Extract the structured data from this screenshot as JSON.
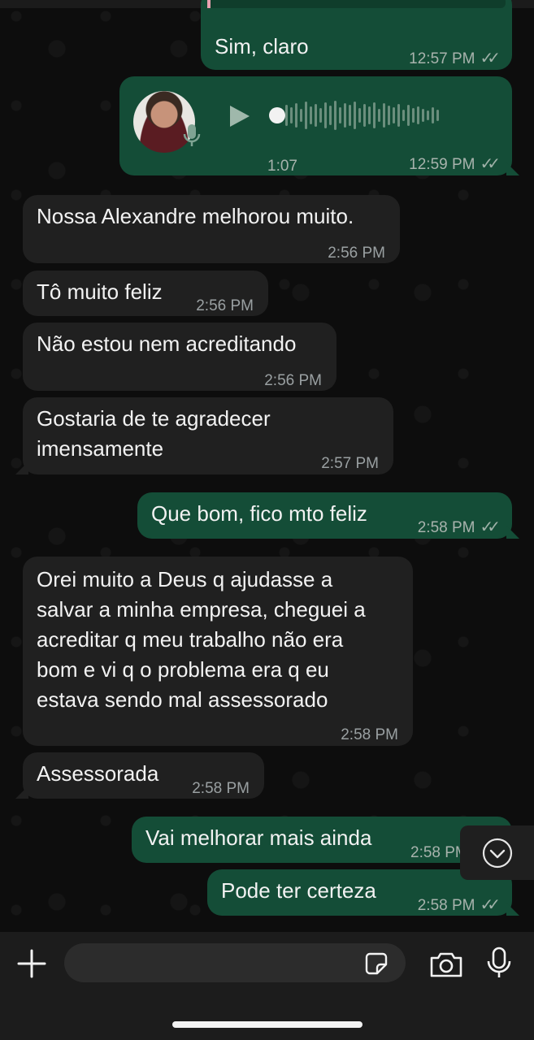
{
  "messages": [
    {
      "text": "Sim, claro",
      "time": "12:57 PM"
    },
    {
      "duration": "1:07",
      "time": "12:59 PM"
    },
    {
      "text": "Nossa Alexandre melhorou muito.",
      "time": "2:56 PM"
    },
    {
      "text": "Tô muito feliz",
      "time": "2:56 PM"
    },
    {
      "text": "Não estou nem acreditando",
      "time": "2:56 PM"
    },
    {
      "text": "Gostaria de te agradecer\nimensamente",
      "time": "2:57 PM"
    },
    {
      "text": "Que bom, fico mto feliz",
      "time": "2:58 PM"
    },
    {
      "text": "Orei muito a Deus q ajudasse a\nsalvar a minha empresa, cheguei a\nacreditar q meu trabalho não era\nbom e vi q o problema era q eu\nestava sendo mal assessorado",
      "time": "2:58 PM"
    },
    {
      "text": "Assessorada",
      "time": "2:58 PM"
    },
    {
      "text": "Vai melhorar mais ainda",
      "time": "2:58 PM"
    },
    {
      "text": "Pode ter certeza",
      "time": "2:58 PM"
    }
  ],
  "read_ticks": "✓✓",
  "composer": {
    "placeholder": ""
  },
  "icons": [
    "plus-icon",
    "sticker-icon",
    "camera-icon",
    "microphone-icon",
    "play-icon",
    "chevron-down-icon"
  ],
  "colors": {
    "outgoing": "#144d37",
    "incoming": "#202020",
    "background": "#0d0d0d"
  }
}
